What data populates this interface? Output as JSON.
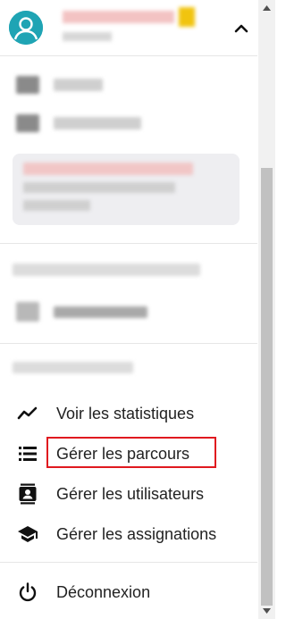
{
  "menu": {
    "statistics_label": "Voir les statistiques",
    "courses_label": "Gérer les parcours",
    "users_label": "Gérer les utilisateurs",
    "assignments_label": "Gérer les assignations",
    "logout_label": "Déconnexion"
  },
  "icons": {
    "avatar": "user-avatar-icon",
    "collapse": "chevron-up-icon",
    "statistics": "line-chart-icon",
    "courses": "list-icon",
    "users": "contact-card-icon",
    "assignments": "graduation-cap-icon",
    "logout": "power-icon"
  },
  "colors": {
    "avatar_bg": "#1fa4b4",
    "highlight_border": "#e0191f",
    "text": "#222222"
  }
}
